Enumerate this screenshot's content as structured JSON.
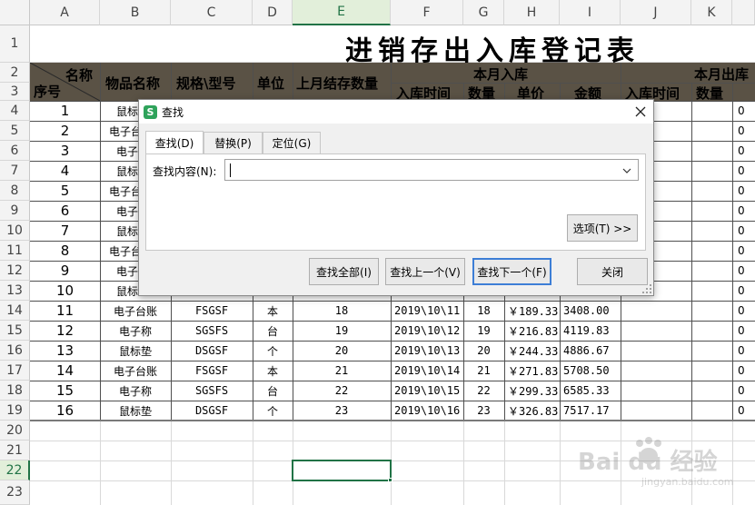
{
  "columns": [
    "A",
    "B",
    "C",
    "D",
    "E",
    "F",
    "G",
    "H",
    "I",
    "J",
    "K"
  ],
  "rows": [
    "1",
    "2",
    "3",
    "4",
    "5",
    "6",
    "7",
    "8",
    "9",
    "10",
    "11",
    "12",
    "13",
    "14",
    "15",
    "16",
    "17",
    "18",
    "19",
    "20",
    "21",
    "22",
    "23"
  ],
  "title": "进销存出入库登记表",
  "headers": {
    "name_corner": "名称",
    "seq": "序号",
    "item_name": "物品名称",
    "spec": "规格\\型号",
    "unit": "单位",
    "last_month_qty": "上月结存数量",
    "in_group": "本月入库",
    "in_time": "入库时间",
    "in_qty": "数量",
    "in_price": "单价",
    "in_amount": "金额",
    "out_group": "本月出库",
    "out_time": "入库时间",
    "out_qty": "数量"
  },
  "partial_rows": [
    {
      "seq": "1",
      "item": "鼠标",
      "k": "0"
    },
    {
      "seq": "2",
      "item": "电子台",
      "k": "0"
    },
    {
      "seq": "3",
      "item": "电子",
      "k": "0"
    },
    {
      "seq": "4",
      "item": "鼠标",
      "k": "0"
    },
    {
      "seq": "5",
      "item": "电子台",
      "k": "0"
    },
    {
      "seq": "6",
      "item": "电子",
      "k": "0"
    },
    {
      "seq": "7",
      "item": "鼠标",
      "k": "0"
    },
    {
      "seq": "8",
      "item": "电子台",
      "k": "0"
    },
    {
      "seq": "9",
      "item": "电子",
      "k": "0"
    },
    {
      "seq": "10",
      "item": "鼠标",
      "k": "0"
    }
  ],
  "full_rows": [
    {
      "seq": "11",
      "item": "电子台账",
      "spec": "FSGSF",
      "unit": "本",
      "last": "18",
      "time": "2019\\10\\11",
      "qty": "18",
      "price": "￥189.33",
      "amount": "3408.00",
      "k": "0"
    },
    {
      "seq": "12",
      "item": "电子称",
      "spec": "SGSFS",
      "unit": "台",
      "last": "19",
      "time": "2019\\10\\12",
      "qty": "19",
      "price": "￥216.83",
      "amount": "4119.83",
      "k": "0"
    },
    {
      "seq": "13",
      "item": "鼠标垫",
      "spec": "DSGSF",
      "unit": "个",
      "last": "20",
      "time": "2019\\10\\13",
      "qty": "20",
      "price": "￥244.33",
      "amount": "4886.67",
      "k": "0"
    },
    {
      "seq": "14",
      "item": "电子台账",
      "spec": "FSGSF",
      "unit": "本",
      "last": "21",
      "time": "2019\\10\\14",
      "qty": "21",
      "price": "￥271.83",
      "amount": "5708.50",
      "k": "0"
    },
    {
      "seq": "15",
      "item": "电子称",
      "spec": "SGSFS",
      "unit": "台",
      "last": "22",
      "time": "2019\\10\\15",
      "qty": "22",
      "price": "￥299.33",
      "amount": "6585.33",
      "k": "0"
    },
    {
      "seq": "16",
      "item": "鼠标垫",
      "spec": "DSGSF",
      "unit": "个",
      "last": "23",
      "time": "2019\\10\\16",
      "qty": "23",
      "price": "￥326.83",
      "amount": "7517.17",
      "k": "0"
    }
  ],
  "dialog": {
    "title": "查找",
    "app_icon": "S",
    "tabs": [
      "查找(D)",
      "替换(P)",
      "定位(G)"
    ],
    "find_label": "查找内容(N):",
    "find_value": "",
    "options_button": "选项(T) >>",
    "find_all": "查找全部(I)",
    "find_prev": "查找上一个(V)",
    "find_next": "查找下一个(F)",
    "close": "关闭"
  },
  "watermark": {
    "brand": "Bai du 经验",
    "url": "jingyan.baidu.com"
  },
  "colors": {
    "header_bg": "#5a5245",
    "accent": "#217346",
    "dialog_primary": "#3d7ed6"
  }
}
